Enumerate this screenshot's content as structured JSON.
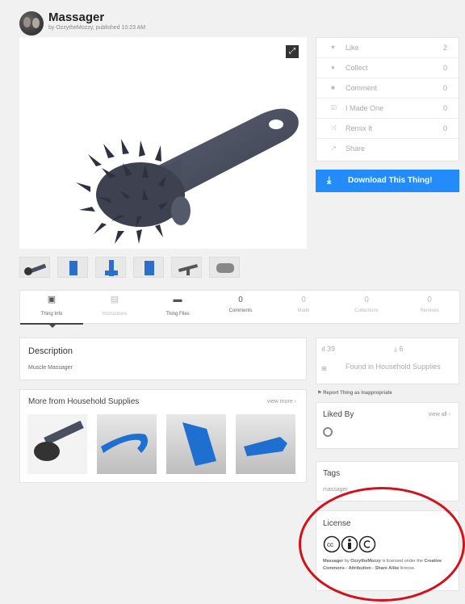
{
  "header": {
    "title": "Massager",
    "byline": "by OzzytheMozzy, published 10:23 AM"
  },
  "viewer": {
    "expand_icon": "expand-icon"
  },
  "stats": [
    {
      "icon": "heart-icon",
      "label": "Like",
      "value": "2"
    },
    {
      "icon": "collect-icon",
      "label": "Collect",
      "value": "0"
    },
    {
      "icon": "comment-icon",
      "label": "Comment",
      "value": "0"
    },
    {
      "icon": "made-icon",
      "label": "I Made One",
      "value": "0"
    },
    {
      "icon": "remix-icon",
      "label": "Remix It",
      "value": "0"
    },
    {
      "icon": "share-icon",
      "label": "Share",
      "value": ""
    }
  ],
  "download": {
    "label": "Download This Thing!"
  },
  "tabs": [
    {
      "label": "Thing Info",
      "num": "",
      "active": true
    },
    {
      "label": "Instructions",
      "num": "",
      "active": false
    },
    {
      "label": "Thing Files",
      "num": "",
      "active": false
    },
    {
      "label": "Comments",
      "num": "0",
      "active": false
    },
    {
      "label": "Made",
      "num": "0",
      "active": false
    },
    {
      "label": "Collections",
      "num": "0",
      "active": false
    },
    {
      "label": "Remixes",
      "num": "0",
      "active": false
    }
  ],
  "description": {
    "title": "Description",
    "text": "Muscle Massager"
  },
  "more": {
    "title": "More from Household Supplies",
    "view_more": "view more ›"
  },
  "side_stats": {
    "views": "39",
    "downloads": "6",
    "found_in": "Found in Household Supplies"
  },
  "report": {
    "label": "Report Thing as Inappropriate"
  },
  "liked_by": {
    "title": "Liked By",
    "view_all": "view all ›"
  },
  "tags": {
    "title": "Tags",
    "items": "massager"
  },
  "license": {
    "title": "License",
    "text_name": "Massager",
    "text_by": " by ",
    "text_author": "OzzytheMozzy",
    "text_mid": " is licensed under the ",
    "text_license": "Creative Commons - Attribution - Share Alike",
    "text_end": " license."
  },
  "colors": {
    "download": "#248bfb",
    "annotation": "#d1121c"
  }
}
